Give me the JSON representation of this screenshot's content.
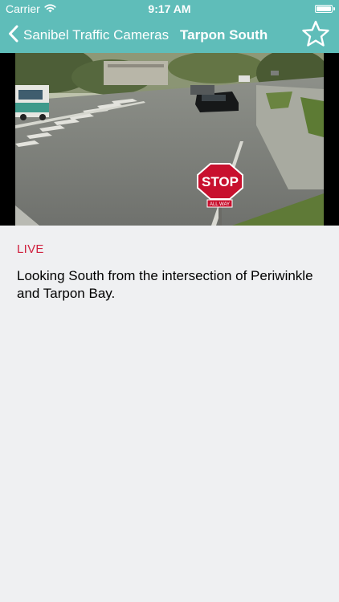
{
  "status_bar": {
    "carrier": "Carrier",
    "time": "9:17 AM",
    "battery_level_percent": 100
  },
  "nav_bar": {
    "back_label": "Sanibel Traffic Cameras",
    "title": "Tarpon South",
    "favorite_icon": "star-outline-icon"
  },
  "camera": {
    "sign_text": "STOP",
    "sign_sub_text": "ALL WAY"
  },
  "content": {
    "live_label": "LIVE",
    "description": "Looking South from the intersection of Periwinkle and Tarpon Bay."
  },
  "colors": {
    "accent": "#5fbdb9",
    "live": "#d0213f",
    "background": "#eff0f2"
  }
}
